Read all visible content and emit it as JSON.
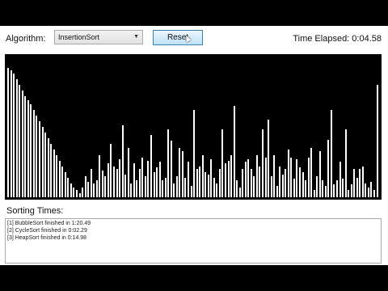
{
  "toolbar": {
    "algorithm_label": "Algorithm:",
    "selected_algorithm": "InsertionSort",
    "reset_label": "Reset",
    "time_elapsed": "Time Elapsed: 0:04.58"
  },
  "bars": [
    0.92,
    0.9,
    0.88,
    0.84,
    0.8,
    0.76,
    0.72,
    0.69,
    0.66,
    0.62,
    0.58,
    0.54,
    0.5,
    0.46,
    0.42,
    0.38,
    0.34,
    0.3,
    0.26,
    0.22,
    0.18,
    0.14,
    0.1,
    0.07,
    0.05,
    0.03,
    0.07,
    0.15,
    0.11,
    0.2,
    0.1,
    0.12,
    0.3,
    0.19,
    0.15,
    0.24,
    0.38,
    0.22,
    0.2,
    0.27,
    0.51,
    0.16,
    0.35,
    0.1,
    0.24,
    0.12,
    0.2,
    0.28,
    0.15,
    0.26,
    0.44,
    0.18,
    0.21,
    0.25,
    0.12,
    0.14,
    0.48,
    0.4,
    0.1,
    0.15,
    0.35,
    0.33,
    0.14,
    0.25,
    0.08,
    0.62,
    0.2,
    0.22,
    0.3,
    0.18,
    0.16,
    0.27,
    0.14,
    0.1,
    0.2,
    0.48,
    0.24,
    0.26,
    0.3,
    0.65,
    0.12,
    0.07,
    0.2,
    0.25,
    0.27,
    0.2,
    0.15,
    0.3,
    0.22,
    0.48,
    0.28,
    0.55,
    0.15,
    0.3,
    0.08,
    0.22,
    0.16,
    0.2,
    0.34,
    0.28,
    0.13,
    0.27,
    0.21,
    0.18,
    0.12,
    0.28,
    0.35,
    0.05,
    0.15,
    0.33,
    0.12,
    0.08,
    0.41,
    0.62,
    0.09,
    0.12,
    0.25,
    0.13,
    0.48,
    0.05,
    0.09,
    0.2,
    0.14,
    0.2,
    0.22,
    0.1,
    0.07,
    0.11,
    0.05,
    0.8
  ],
  "sorting_times_label": "Sorting Times:",
  "sorting_times": [
    "[1] BubbleSort finished in 1:20.49",
    "[2] CycleSort finished in 0:02.29",
    "[3] HeapSort finished in 0:14.98"
  ]
}
